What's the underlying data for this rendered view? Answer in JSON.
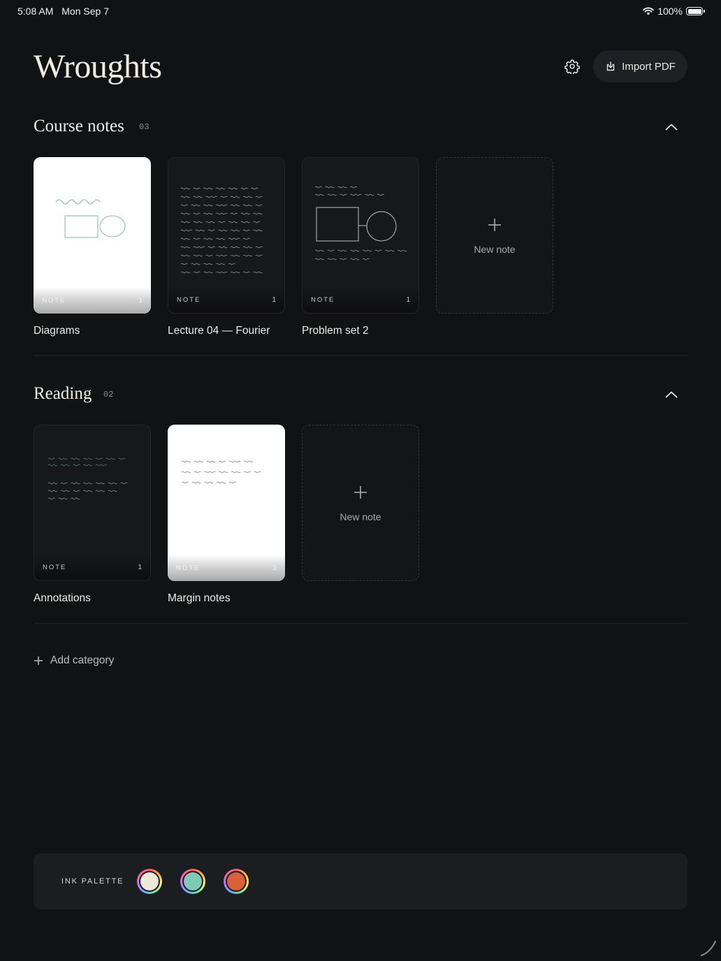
{
  "status_bar": {
    "time": "5:08 AM",
    "date": "Mon Sep 7",
    "battery": "100%"
  },
  "header": {
    "title": "Wroughts",
    "import_label": "Import PDF"
  },
  "sections": [
    {
      "title": "Course notes",
      "count": "03",
      "notes": [
        {
          "title": "Diagrams",
          "tag": "NOTE",
          "pages": "1"
        },
        {
          "title": "Lecture 04 — Fourier",
          "tag": "NOTE",
          "pages": "1"
        },
        {
          "title": "Problem set 2",
          "tag": "NOTE",
          "pages": "1"
        }
      ],
      "new_note_label": "New note"
    },
    {
      "title": "Reading",
      "count": "02",
      "notes": [
        {
          "title": "Annotations",
          "tag": "NOTE",
          "pages": "1"
        },
        {
          "title": "Margin notes",
          "tag": "NOTE",
          "pages": "1"
        }
      ],
      "new_note_label": "New note"
    }
  ],
  "add_category_label": "Add category",
  "palette": {
    "label": "INK PALETTE",
    "colors": [
      "#ece8d8",
      "#7ecab4",
      "#d9603a"
    ]
  }
}
